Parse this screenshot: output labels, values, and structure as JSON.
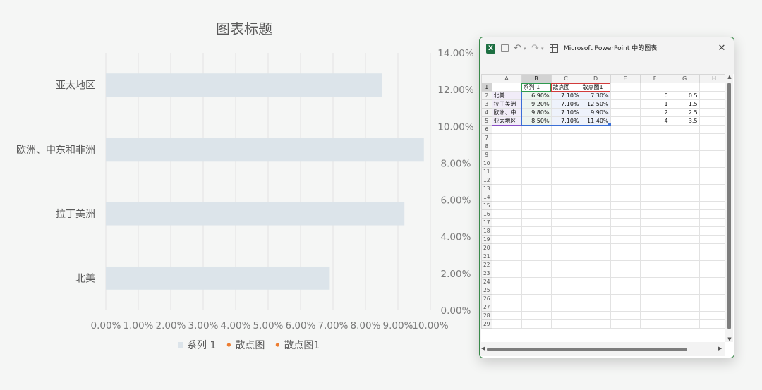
{
  "chart_data": {
    "type": "bar",
    "title": "图表标题",
    "orientation": "horizontal",
    "categories": [
      "北美",
      "拉丁美洲",
      "欧洲、中东和非洲",
      "亚太地区"
    ],
    "series": [
      {
        "name": "系列 1",
        "type": "bar",
        "values": [
          6.9,
          9.2,
          9.8,
          8.5
        ],
        "color": "#dce4ea"
      },
      {
        "name": "散点图",
        "type": "scatter",
        "x": [
          7.1,
          7.1,
          7.1,
          7.1
        ],
        "y": [
          0,
          1,
          2,
          4
        ],
        "color": "#ed7d31"
      },
      {
        "name": "散点图1",
        "type": "scatter",
        "x": [
          7.3,
          12.5,
          9.9,
          11.4
        ],
        "y": [
          0.5,
          1.5,
          2.5,
          3.5
        ],
        "color": "#ed7d31"
      }
    ],
    "x_axis": {
      "min": 0,
      "max": 10,
      "step": 1,
      "ticks": [
        "0.00%",
        "1.00%",
        "2.00%",
        "3.00%",
        "4.00%",
        "5.00%",
        "6.00%",
        "7.00%",
        "8.00%",
        "9.00%",
        "10.00%"
      ]
    },
    "secondary_y_axis": {
      "min": 0,
      "max": 14,
      "step": 2,
      "ticks": [
        "0.00%",
        "2.00%",
        "4.00%",
        "6.00%",
        "8.00%",
        "10.00%",
        "12.00%",
        "14.00%"
      ]
    },
    "grid": "vertical",
    "legend_position": "bottom"
  },
  "spreadsheet": {
    "window_title": "Microsoft PowerPoint 中的图表",
    "excel_badge": "X",
    "column_headers": [
      "A",
      "B",
      "C",
      "D",
      "E",
      "F",
      "G",
      "H"
    ],
    "row_count": 29,
    "rows": [
      [
        "",
        "系列 1",
        "散点图",
        "散点图1",
        "",
        "",
        "",
        ""
      ],
      [
        "北美",
        "6.90%",
        "7.10%",
        "7.30%",
        "",
        "0",
        "0.5",
        ""
      ],
      [
        "拉丁美洲",
        "9.20%",
        "7.10%",
        "12.50%",
        "",
        "1",
        "1.5",
        ""
      ],
      [
        "欧洲、中",
        "9.80%",
        "7.10%",
        "9.90%",
        "",
        "2",
        "2.5",
        ""
      ],
      [
        "亚太地区",
        "8.50%",
        "7.10%",
        "11.40%",
        "",
        "4",
        "3.5",
        ""
      ]
    ]
  },
  "icons": {
    "undo": "↶",
    "redo": "↷",
    "dropdown": "▾",
    "close": "✕",
    "scroll_up": "▲",
    "scroll_down": "▼",
    "scroll_left": "◀",
    "scroll_right": "▶"
  }
}
